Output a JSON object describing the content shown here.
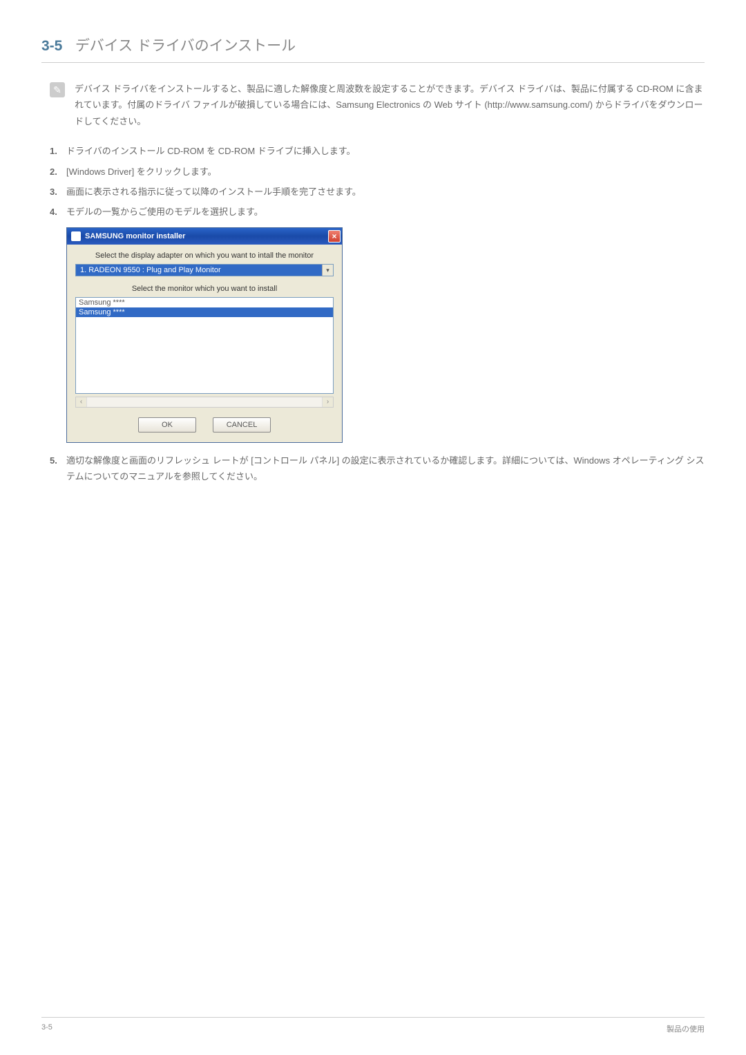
{
  "heading": {
    "number": "3-5",
    "title": "デバイス ドライバのインストール"
  },
  "note": {
    "text": "デバイス ドライバをインストールすると、製品に適した解像度と周波数を設定することができます。デバイス ドライバは、製品に付属する CD-ROM に含まれています。付属のドライバ ファイルが破損している場合には、Samsung Electronics の Web サイト (http://www.samsung.com/) からドライバをダウンロードしてください。"
  },
  "steps": [
    {
      "num": "1.",
      "text": "ドライバのインストール CD-ROM を CD-ROM ドライブに挿入します。"
    },
    {
      "num": "2.",
      "text": "[Windows Driver] をクリックします。"
    },
    {
      "num": "3.",
      "text": "画面に表示される指示に従って以降のインストール手順を完了させます。"
    },
    {
      "num": "4.",
      "text": "モデルの一覧からご使用のモデルを選択します。"
    }
  ],
  "installer": {
    "title": "SAMSUNG monitor installer",
    "close": "×",
    "label1": "Select the display adapter on which you want to intall the monitor",
    "adapter": "1. RADEON 9550 : Plug and Play Monitor",
    "label2": "Select the monitor which you want to install",
    "monitors": [
      "Samsung ****",
      "Samsung ****"
    ],
    "ok": "OK",
    "cancel": "CANCEL",
    "arrow_left": "‹",
    "arrow_right": "›",
    "dropdown_arrow": "▾"
  },
  "step5": {
    "num": "5.",
    "text": "適切な解像度と画面のリフレッシュ レートが [コントロール パネル] の設定に表示されているか確認します。詳細については、Windows オペレーティング システムについてのマニュアルを参照してください。"
  },
  "footer": {
    "left": "3-5",
    "right": "製品の使用"
  }
}
